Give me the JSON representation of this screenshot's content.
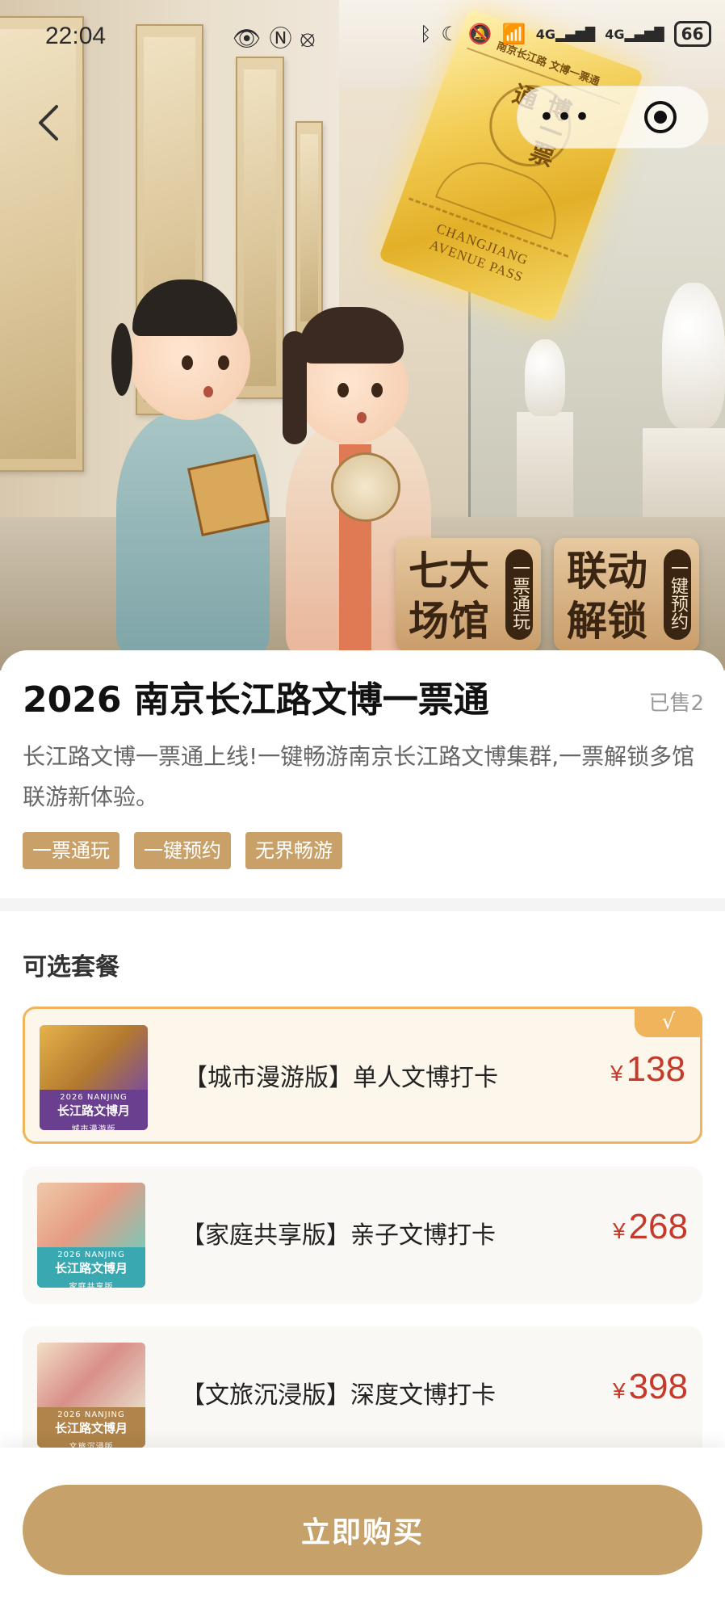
{
  "status_bar": {
    "time": "22:04",
    "left_icons": [
      "eye-icon",
      "nfc-icon",
      "vibrate-icon"
    ],
    "right_icons": [
      "bluetooth-icon",
      "moon-icon",
      "mute-icon",
      "wifi-icon",
      "signal-4g-icon",
      "signal-4g-icon"
    ],
    "network_1": "4G",
    "network_2": "4G",
    "battery": "66"
  },
  "hero": {
    "ticket_brand": "南京长江路 文博一票通",
    "ticket_seal": "博一票通",
    "ticket_pass_line1": "CHANGJIANG",
    "ticket_pass_line2": "AVENUE PASS",
    "badge_1": {
      "title_line1": "七大",
      "title_line2": "场馆",
      "pill": "一票通玩"
    },
    "badge_2": {
      "title_line1": "联动",
      "title_line2": "解锁",
      "pill": "一键预约"
    }
  },
  "nav": {
    "more_label": "•••",
    "icons": [
      "back-icon",
      "more-icon",
      "target-icon"
    ]
  },
  "product": {
    "title": "2026 南京长江路文博一票通",
    "sold": "已售2",
    "description": "长江路文博一票通上线!一键畅游南京长江路文博集群,一票解锁多馆联游新体验。",
    "tags": [
      "一票通玩",
      "一键预约",
      "无界畅游"
    ]
  },
  "packages": {
    "section_title": "可选套餐",
    "check_mark": "√",
    "items": [
      {
        "name": "【城市漫游版】单人文博打卡",
        "currency": "¥",
        "price": "138",
        "thumb_year": "2026 NANJING",
        "thumb_title": "长江路文博月",
        "thumb_edition": "城市漫游版",
        "selected": true
      },
      {
        "name": "【家庭共享版】亲子文博打卡",
        "currency": "¥",
        "price": "268",
        "thumb_year": "2026 NANJING",
        "thumb_title": "长江路文博月",
        "thumb_edition": "家庭共享版",
        "selected": false
      },
      {
        "name": "【文旅沉浸版】深度文博打卡",
        "currency": "¥",
        "price": "398",
        "thumb_year": "2026 NANJING",
        "thumb_title": "长江路文博月",
        "thumb_edition": "文旅沉浸版",
        "selected": false
      }
    ]
  },
  "buy_button": "立即购买",
  "colors": {
    "accent": "#c6a26a",
    "tag_bg": "#c8a068",
    "price": "#c63a2b",
    "selected_border": "#f0b45c"
  }
}
